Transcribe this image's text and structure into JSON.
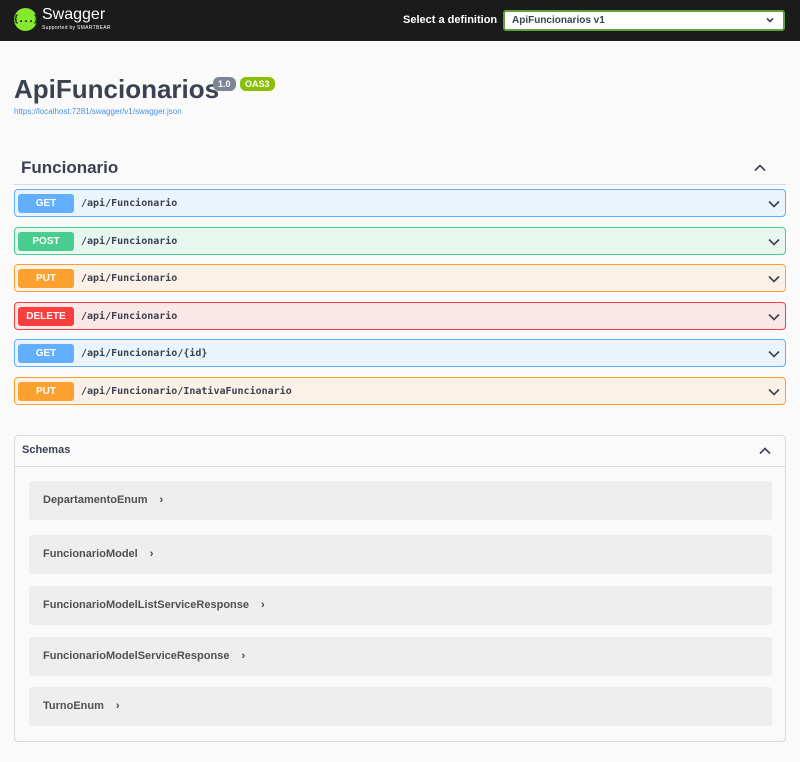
{
  "topbar": {
    "logo_name": "Swagger",
    "logo_sub": "Supported by SMARTBEAR",
    "logo_glyph": "{...}",
    "definition_label": "Select a definition",
    "definition_selected": "ApiFuncionarios v1"
  },
  "info": {
    "title": "ApiFuncionarios",
    "version": "1.0",
    "oas": "OAS3",
    "spec_url": "https://localhost:7281/swagger/v1/swagger.json"
  },
  "tag": {
    "name": "Funcionario",
    "operations": [
      {
        "method": "GET",
        "path": "/api/Funcionario"
      },
      {
        "method": "POST",
        "path": "/api/Funcionario"
      },
      {
        "method": "PUT",
        "path": "/api/Funcionario"
      },
      {
        "method": "DELETE",
        "path": "/api/Funcionario"
      },
      {
        "method": "GET",
        "path": "/api/Funcionario/{id}"
      },
      {
        "method": "PUT",
        "path": "/api/Funcionario/InativaFuncionario"
      }
    ]
  },
  "schemas": {
    "title": "Schemas",
    "models": [
      "DepartamentoEnum",
      "FuncionarioModel",
      "FuncionarioModelListServiceResponse",
      "FuncionarioModelServiceResponse",
      "TurnoEnum"
    ],
    "expand_glyph": "›"
  },
  "colors": {
    "topbar": "#1b1b1b",
    "brand": "#85ea2d",
    "get": "#61affe",
    "post": "#49cc90",
    "put": "#fca130",
    "delete": "#f93e3e"
  }
}
